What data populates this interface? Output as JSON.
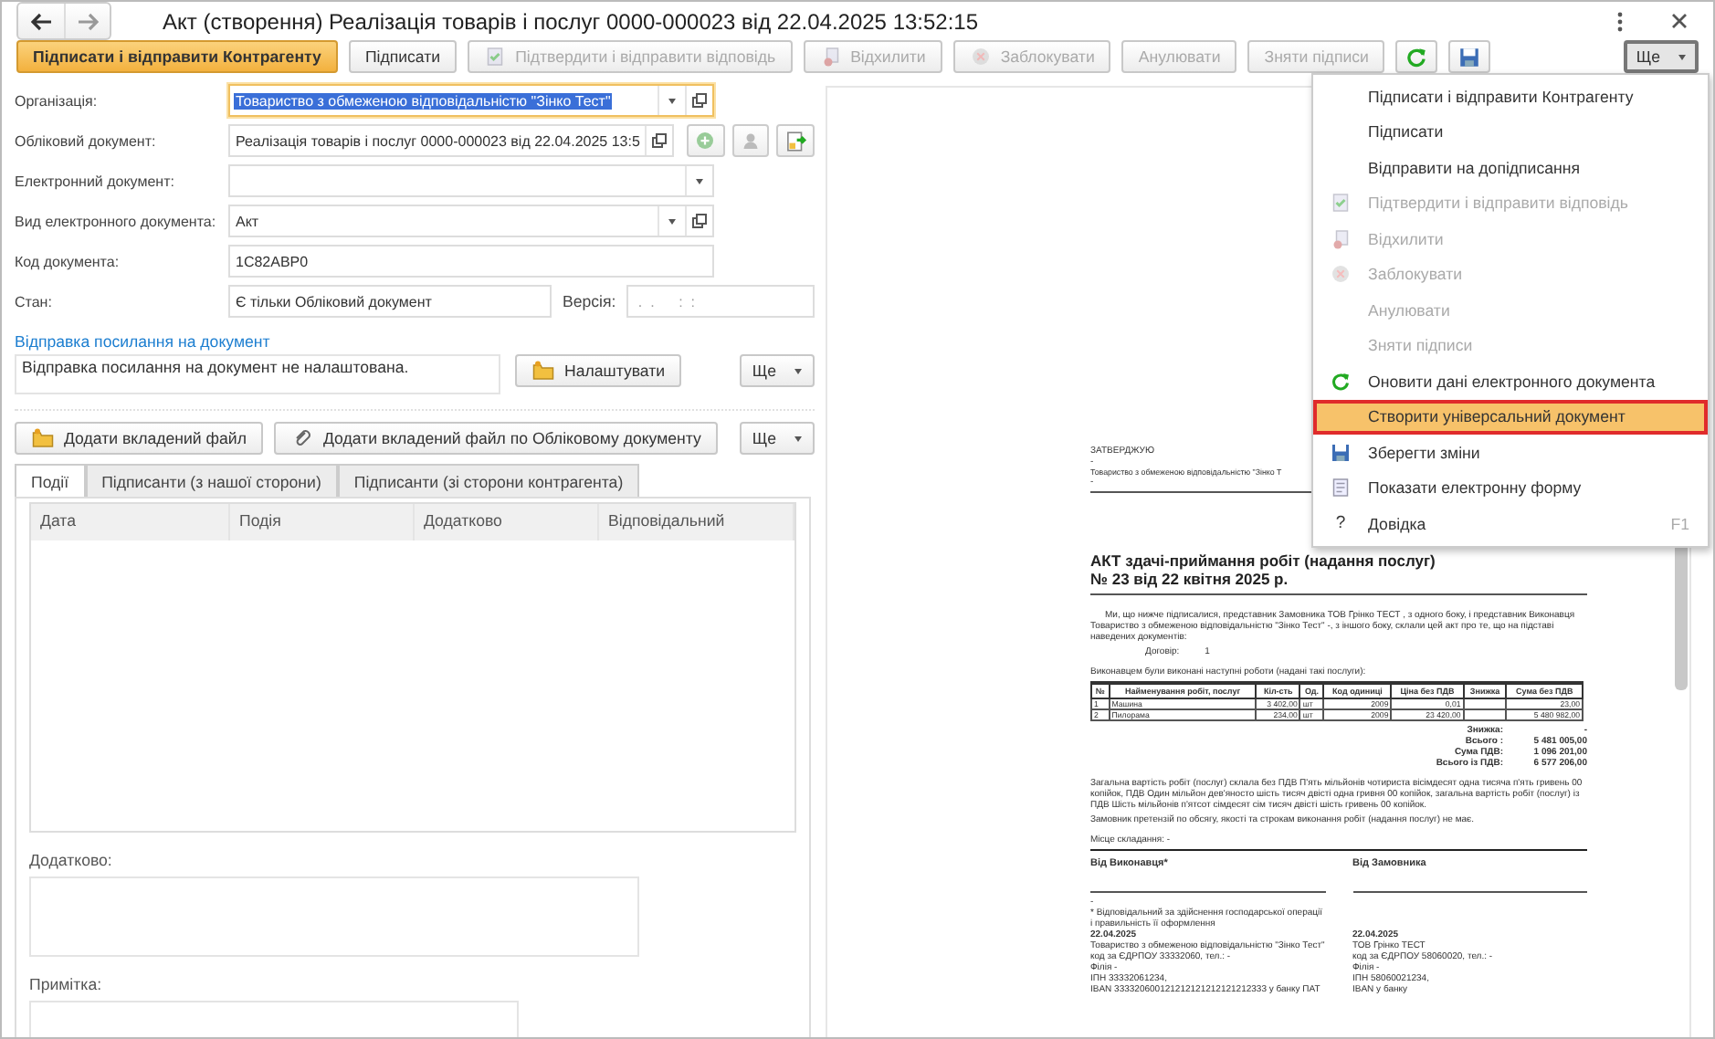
{
  "window": {
    "title": "Акт (створення) Реалізація товарів і послуг 0000-000023 від 22.04.2025 13:52:15"
  },
  "toolbar": {
    "buttons": [
      {
        "label": "Підписати і відправити Контрагенту",
        "kind": "primary",
        "disabled": false
      },
      {
        "label": "Підписати",
        "kind": "normal",
        "disabled": false
      },
      {
        "label": "Підтвердити і відправити відповідь",
        "kind": "normal",
        "disabled": true
      },
      {
        "label": "Відхилити",
        "kind": "normal",
        "disabled": true
      },
      {
        "label": "Заблокувати",
        "kind": "normal",
        "disabled": true
      },
      {
        "label": "Анулювати",
        "kind": "normal",
        "disabled": true
      },
      {
        "label": "Зняти підписи",
        "kind": "normal",
        "disabled": true
      }
    ],
    "more": {
      "label": "Ще",
      "pressed": true
    }
  },
  "fields": [
    {
      "label": "Організація:",
      "value": "Товариство з обмеженою відповідальністю \"Зінко Тест\"",
      "focused": true,
      "dropdown": true,
      "open": true
    },
    {
      "label": "Обліковий документ:",
      "value": "Реалізація товарів і послуг 0000-000023 від 22.04.2025 13:5",
      "focused": false,
      "dropdown": false,
      "open": true
    },
    {
      "label": "Електронний документ:",
      "focused": false,
      "dropdown": true,
      "open": false
    },
    {
      "label": "Вид електронного документа:",
      "value": "Акт",
      "focused": false,
      "dropdown": true,
      "open": true
    },
    {
      "label": "Код документа:",
      "value": "1C82ABP0",
      "focused": false,
      "dropdown": false,
      "open": false
    },
    {
      "label": "Стан:",
      "value": "Є тільки Обліковий документ",
      "focused": false,
      "dropdown": false,
      "open": false
    }
  ],
  "version": {
    "label": "Версія:",
    "placeholder": " .  .      :  :"
  },
  "link_section": {
    "title": "Відправка посилання на документ",
    "text": "Відправка посилання на документ не налаштована.",
    "button": "Налаштувати",
    "more": "Ще"
  },
  "attach": {
    "buttons": [
      "Додати вкладений файл",
      "Додати вкладений файл по Обліковому документу"
    ],
    "more": "Ще"
  },
  "tabs": [
    {
      "label": "Події",
      "selected": true
    },
    {
      "label": "Підписанти (з нашої сторони)",
      "selected": false
    },
    {
      "label": "Підписанти (зі сторони контрагента)",
      "selected": false
    }
  ],
  "table": {
    "columns": [
      "Дата",
      "Подія",
      "Додатково",
      "Відповідальний"
    ]
  },
  "extra": {
    "label": "Додатково:"
  },
  "note": {
    "label": "Примітка:"
  },
  "document": {
    "approve": "ЗАТВЕРДЖУЮ",
    "approve_dash": "-",
    "approve_org": "Товариство з обмеженою відповідальністю \"Зінко Т",
    "approve_dash2": "-",
    "title": "АКТ здачі-приймання робіт (надання послуг)",
    "number": "№ 23 від 22 квітня 2025 р.",
    "intro": "Ми, що нижче підписалися, представник Замовника ТОВ Грінко ТЕСТ        , з одного боку, і представник Виконавця Товариство з обмеженою відповідальністю \"Зінко Тест\"        -, з іншого боку, склали цей акт про те, що на підставі наведених документів:",
    "contract": {
      "label": "Договір:",
      "value": "1"
    },
    "works_caption": "Виконавцем були виконані наступні роботи (надані такі послуги):",
    "columns": [
      "№",
      "Найменування робіт, послуг",
      "Кіл-сть",
      "Од.",
      "Код одиниці",
      "Ціна без ПДВ",
      "Знижка",
      "Сума без ПДВ"
    ],
    "rows": [
      [
        "1",
        "Машина",
        "3 402,00",
        "шт",
        "2009",
        "0,01",
        "",
        "23,00"
      ],
      [
        "2",
        "Пилорама",
        "234,00",
        "шт",
        "2009",
        "23 420,00",
        "",
        "5 480 982,00"
      ]
    ],
    "totals": [
      {
        "label": "Знижка:",
        "value": "-"
      },
      {
        "label": "Всього :",
        "value": "5 481 005,00"
      },
      {
        "label": "Сума ПДВ:",
        "value": "1 096 201,00"
      },
      {
        "label": "Всього із ПДВ:",
        "value": "6 577 206,00"
      }
    ],
    "sum_text": "Загальна вартість робіт (послуг) склала без ПДВ П'ять мільйонів чотириста вісімдесят одна тисяча п'ять гривень 00 копійок, ПДВ Один мільйон дев'яносто шість тисяч двісті одна гривня 00 копійок, загальна вартість робіт (послуг) із ПДВ Шість мільйонів п'ятсот сімдесят сім тисяч двісті шість гривень 00 копійок.",
    "claims": "Замовник претензій по обсягу, якості та строкам виконання робіт (надання послуг) не має.",
    "place": "Місце складання:   -",
    "parties": [
      {
        "title": "Від Виконавця*",
        "dash": "-",
        "footnote": "* Відповідальний за здійснення господарської операції і правильність її оформлення",
        "lines": [
          "22.04.2025",
          "Товариство з обмеженою відповідальністю \"Зінко Тест\"",
          "код за ЄДРПОУ 33332060, тел.: -",
          "Філія -",
          "ІПН 33332061234,",
          "IBAN 333320600121212121212121212333 у банку ПАТ"
        ]
      },
      {
        "title": "Від Замовника",
        "lines": [
          "22.04.2025",
          "ТОВ Грінко ТЕСТ",
          "код за ЄДРПОУ 58060020, тел.: -",
          "Філія -",
          "ІПН 58060021234,",
          "IBAN          у банку"
        ]
      }
    ]
  },
  "menu": {
    "items": [
      {
        "label": "Підписати і відправити Контрагенту",
        "disabled": false,
        "selected": false
      },
      {
        "label": "Підписати",
        "disabled": false,
        "selected": false
      },
      {
        "label": "Відправити на допідписання",
        "disabled": false,
        "selected": false
      },
      {
        "label": "Підтвердити і відправити відповідь",
        "disabled": true,
        "selected": false
      },
      {
        "label": "Відхилити",
        "disabled": true,
        "selected": false
      },
      {
        "label": "Заблокувати",
        "disabled": true,
        "selected": false
      },
      {
        "label": "Анулювати",
        "disabled": true,
        "selected": false
      },
      {
        "label": "Зняти підписи",
        "disabled": true,
        "selected": false
      },
      {
        "label": "Оновити дані електронного документа",
        "disabled": false,
        "selected": false
      },
      {
        "label": "Створити універсальний документ",
        "disabled": false,
        "selected": true
      },
      {
        "label": "Зберегти зміни",
        "disabled": false,
        "selected": false
      },
      {
        "label": "Показати електронну форму",
        "disabled": false,
        "selected": false
      },
      {
        "label": "Довідка",
        "mark": "?",
        "shortcut": "F1",
        "disabled": false,
        "selected": false
      }
    ]
  }
}
